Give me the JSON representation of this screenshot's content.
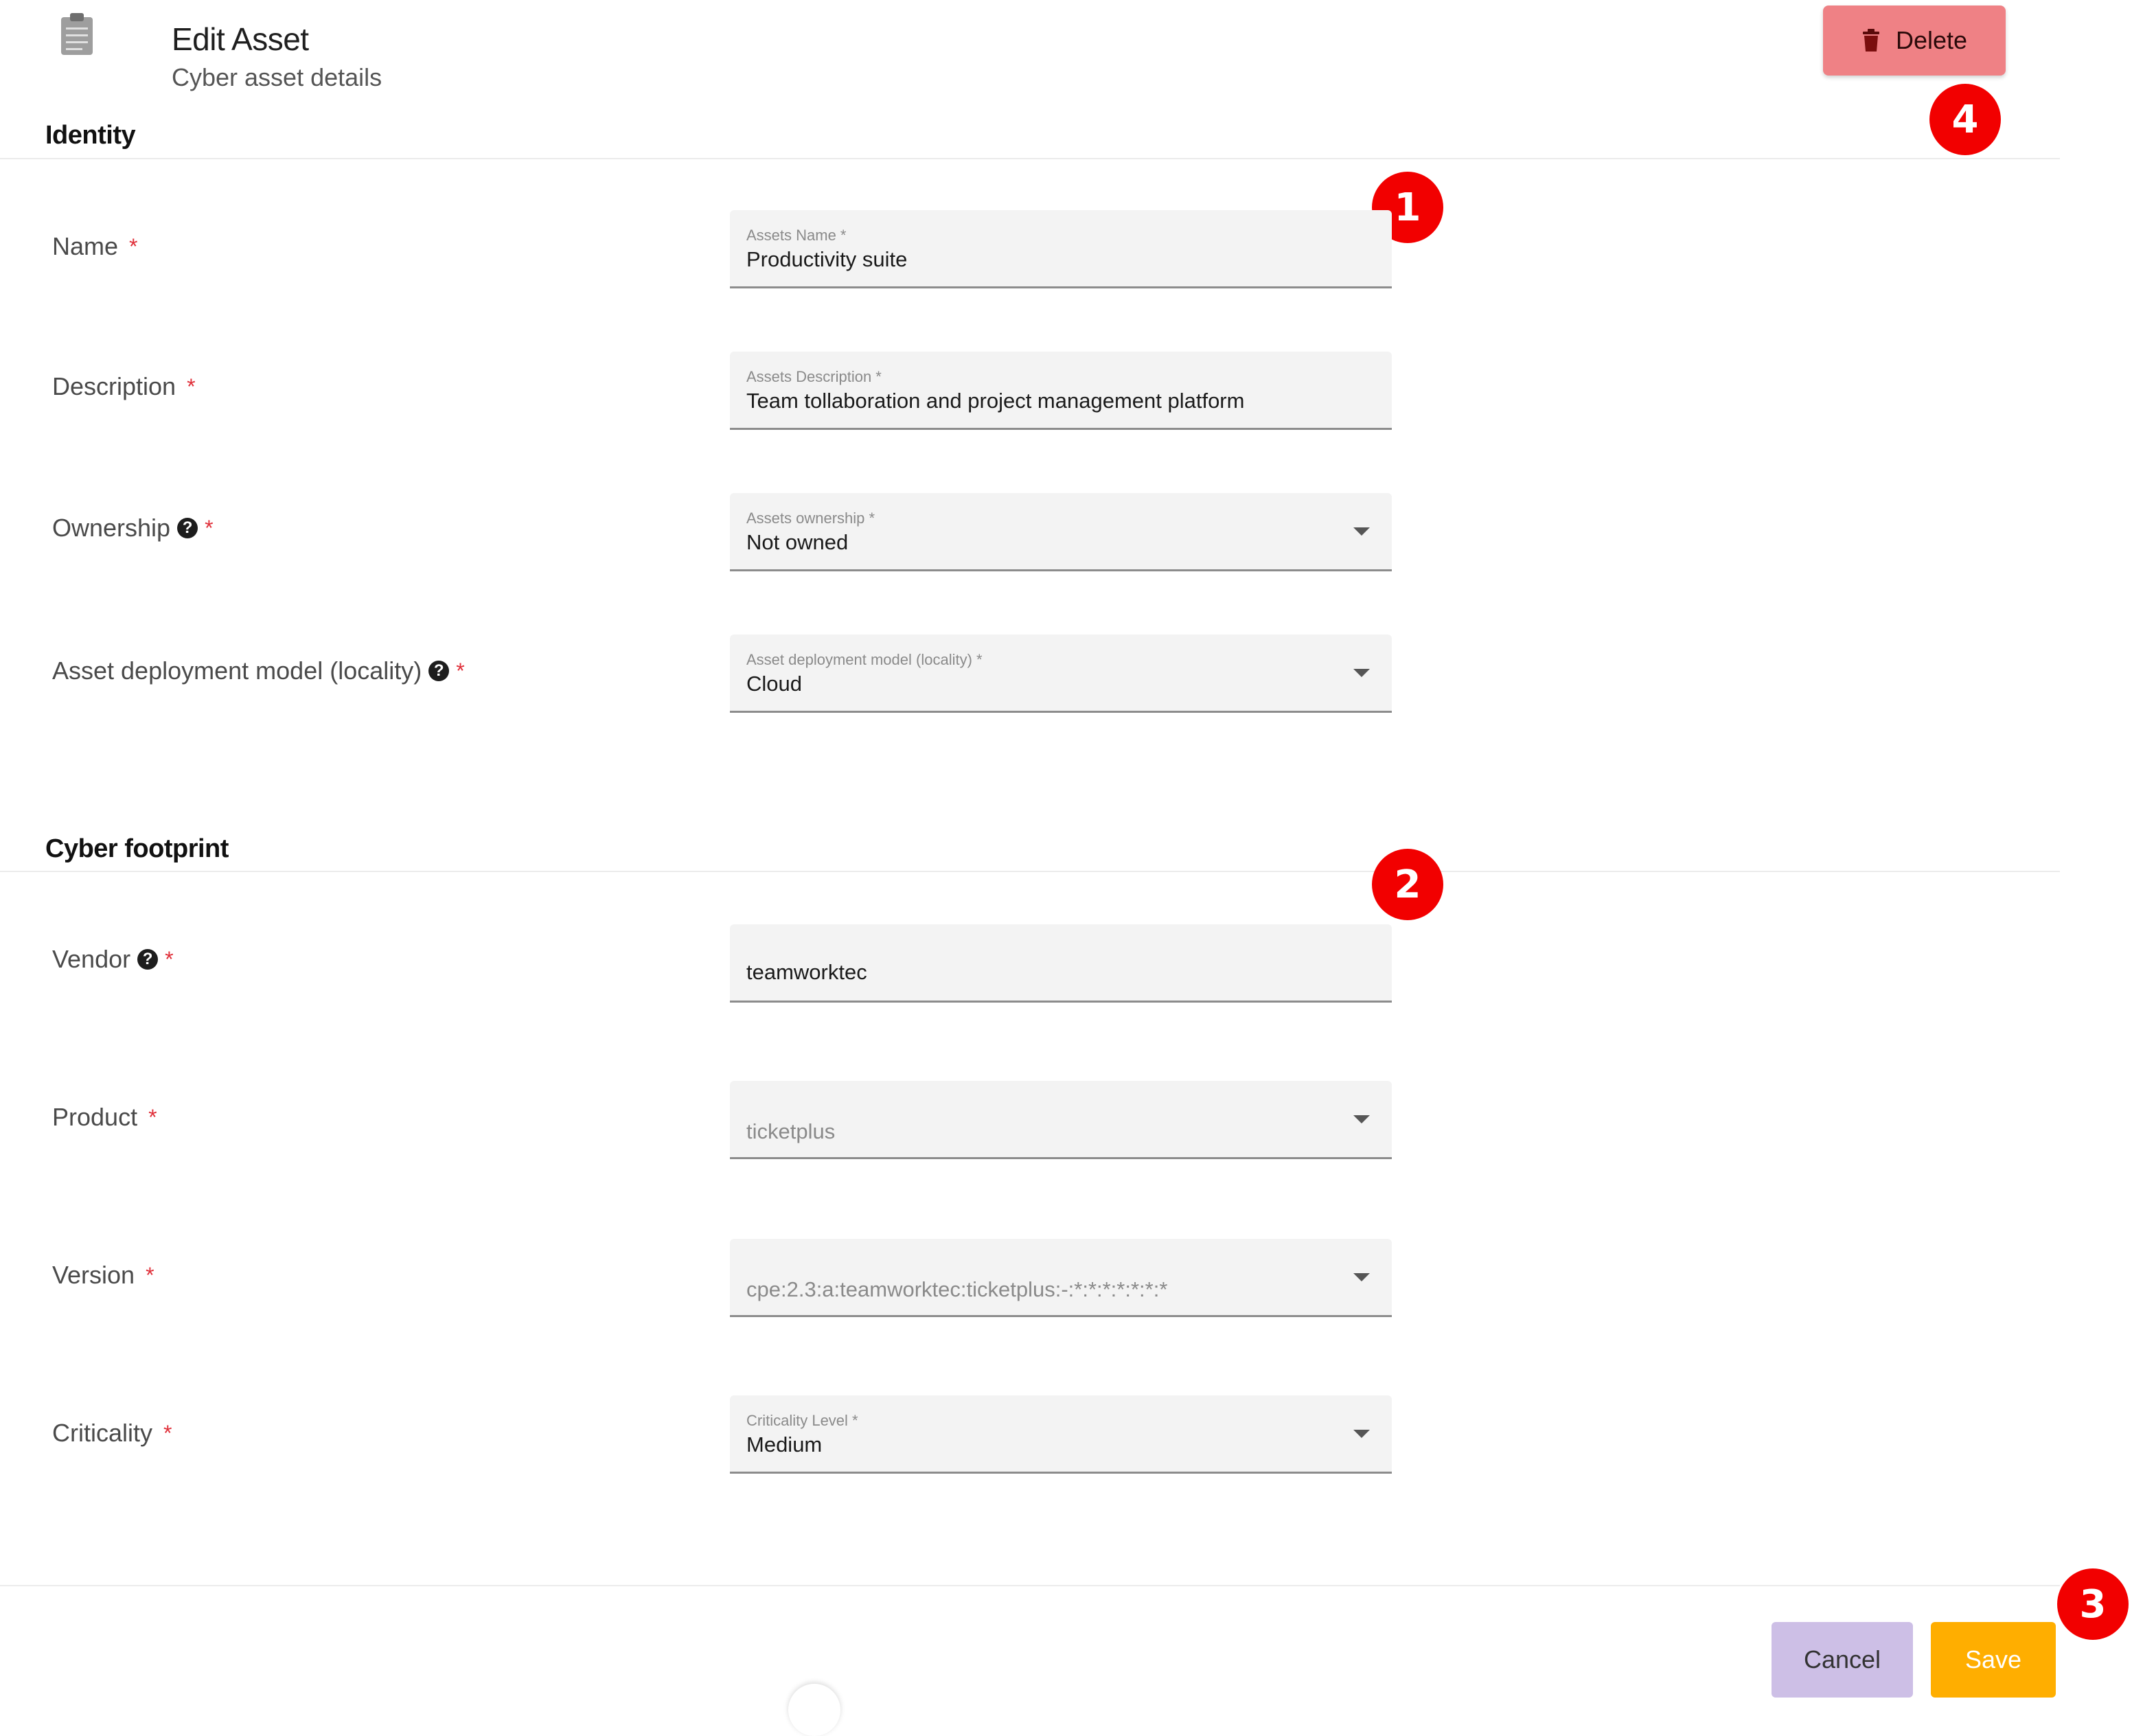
{
  "header": {
    "title": "Edit Asset",
    "subtitle": "Cyber asset details",
    "delete_label": "Delete"
  },
  "sections": {
    "identity": "Identity",
    "cyber_footprint": "Cyber footprint"
  },
  "fields": {
    "name": {
      "label": "Name",
      "required": "*",
      "float_label": "Assets Name *",
      "value": "Productivity suite"
    },
    "description": {
      "label": "Description",
      "required": "*",
      "float_label": "Assets Description *",
      "value": "Team tollaboration and project management platform"
    },
    "ownership": {
      "label": "Ownership",
      "help": "?",
      "required": "*",
      "float_label": "Assets ownership *",
      "value": "Not owned"
    },
    "deployment": {
      "label": "Asset deployment model (locality)",
      "help": "?",
      "required": "*",
      "float_label": "Asset deployment model (locality) *",
      "value": "Cloud"
    },
    "vendor": {
      "label": "Vendor",
      "help": "?",
      "required": "*",
      "value": "teamworktec"
    },
    "product": {
      "label": "Product",
      "required": "*",
      "value": "ticketplus"
    },
    "version": {
      "label": "Version",
      "required": "*",
      "value": "cpe:2.3:a:teamworktec:ticketplus:-:*:*:*:*:*:*:*"
    },
    "criticality": {
      "label": "Criticality",
      "required": "*",
      "float_label": "Criticality Level *",
      "value": "Medium"
    }
  },
  "footer": {
    "cancel_label": "Cancel",
    "save_label": "Save"
  },
  "annotations": {
    "b1": "1",
    "b2": "2",
    "b3": "3",
    "b4": "4"
  },
  "icons": {
    "header": "clipboard-icon",
    "delete": "trash-icon",
    "help": "help-circle-icon",
    "dropdown": "caret-down-icon"
  },
  "colors": {
    "delete_bg": "#ef8185",
    "save_bg": "#ffae00",
    "cancel_bg": "#cdbfe6",
    "required": "#e0303a",
    "badge": "#f20000"
  }
}
